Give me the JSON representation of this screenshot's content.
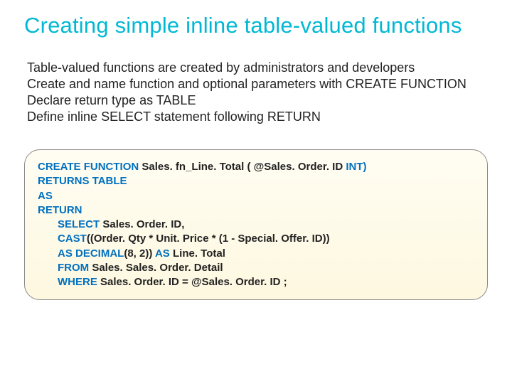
{
  "title": "Creating simple inline table-valued functions",
  "body": {
    "line1": "Table-valued functions are created by administrators and developers",
    "line2": "Create and name function and optional parameters with CREATE FUNCTION",
    "line3": "Declare return type as TABLE",
    "line4": "Define inline SELECT statement following RETURN"
  },
  "code": {
    "t01": "CREATE FUNCTION ",
    "t02": "Sales. fn_Line. Total ( ",
    "t03": "@Sales. Order. ID ",
    "t04": "INT)",
    "t05": "RETURNS TABLE",
    "t06": "AS",
    "t07": "RETURN",
    "t08": "SELECT ",
    "t09": "Sales. Order. ID,",
    "t10": "CAST",
    "t11": "((Order. Qty * Unit. Price * (1 - Special. Offer. ID))",
    "t12": "AS DECIMAL",
    "t13": "(8, 2)) ",
    "t14": "AS ",
    "t15": "Line. Total",
    "t16": "FROM ",
    "t17": "   Sales. Sales. Order. Detail",
    "t18": "WHERE ",
    "t19": "  Sales. Order. ID = @Sales. Order. ID ;"
  }
}
